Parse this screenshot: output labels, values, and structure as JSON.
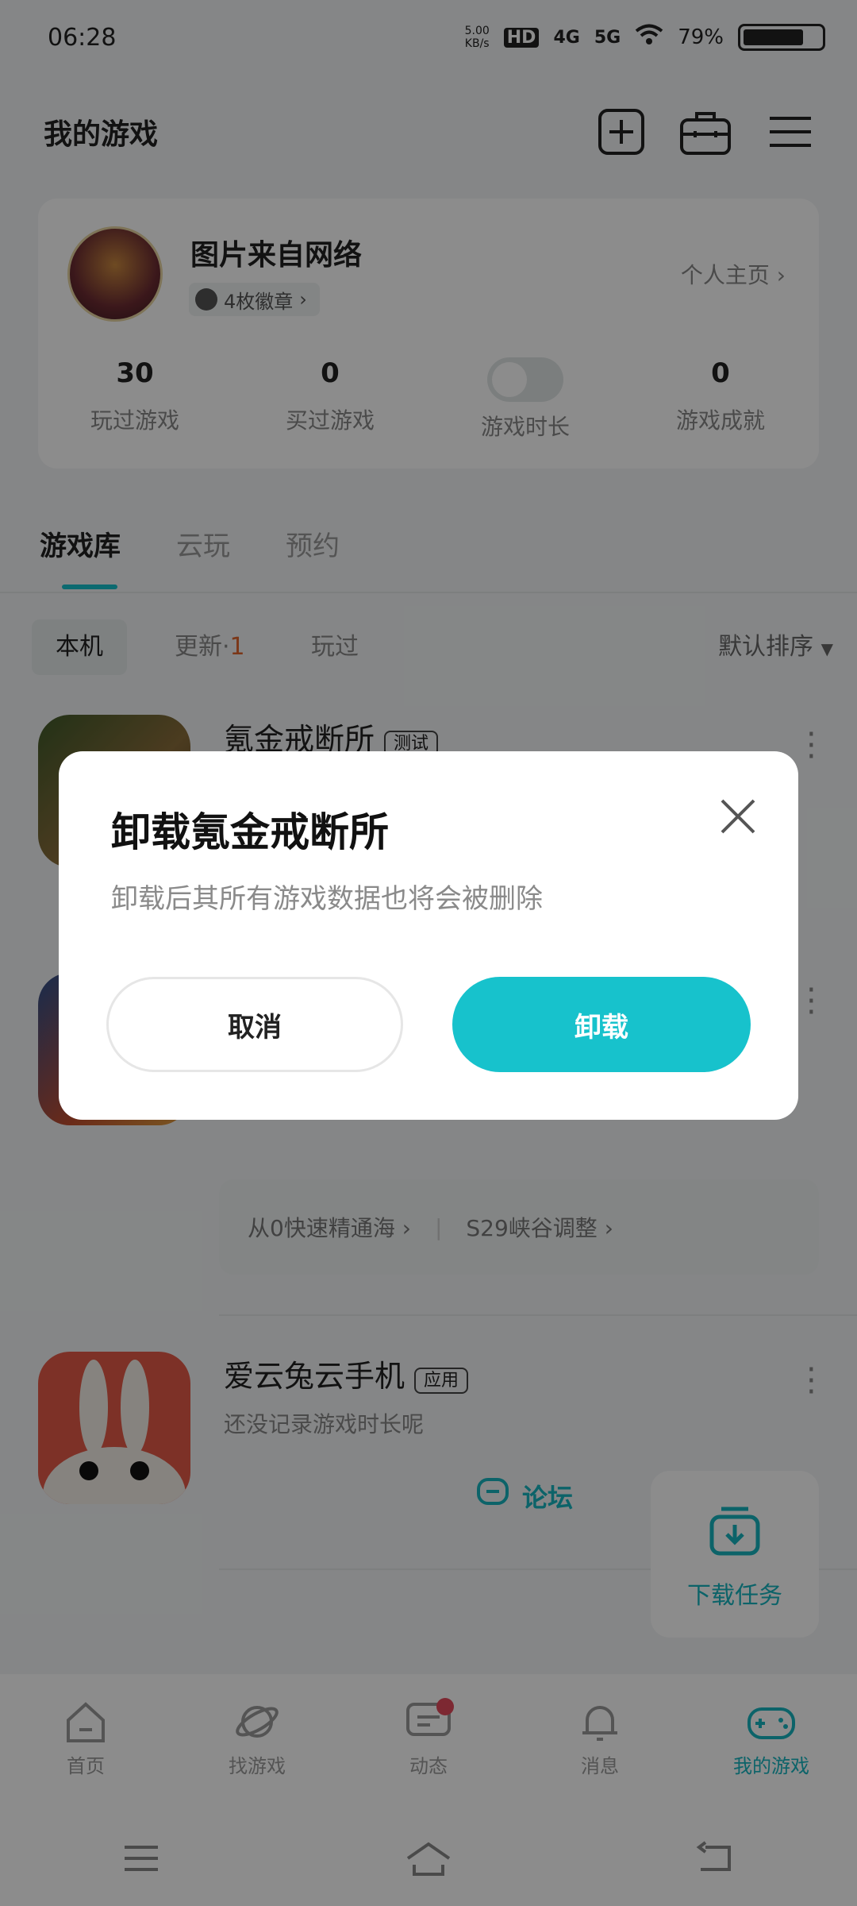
{
  "status": {
    "time": "06:28",
    "speed_top": "5.00",
    "speed_bottom": "KB/s",
    "hd": "HD",
    "net1": "4G",
    "net2": "5G",
    "battery": "79%"
  },
  "header": {
    "title": "我的游戏"
  },
  "profile": {
    "name": "图片来自网络",
    "badge": "4枚徽章",
    "homepage": "个人主页",
    "stats": [
      {
        "num": "30",
        "label": "玩过游戏"
      },
      {
        "num": "0",
        "label": "买过游戏"
      },
      {
        "num": "",
        "label": "游戏时长"
      },
      {
        "num": "0",
        "label": "游戏成就"
      }
    ]
  },
  "tabs": [
    "游戏库",
    "云玩",
    "预约"
  ],
  "filters": {
    "local": "本机",
    "update": "更新",
    "update_dot": "·",
    "update_count": "1",
    "played": "玩过",
    "sort": "默认排序"
  },
  "games": [
    {
      "name": "氪金戒断所",
      "tag": "测试"
    },
    {
      "strip_1": "从0快速精通海",
      "strip_2": "S29峡谷调整"
    },
    {
      "name": "爱云兔云手机",
      "tag": "应用",
      "sub": "还没记录游戏时长呢",
      "forum": "论坛"
    }
  ],
  "download": {
    "label": "下载任务"
  },
  "nav": [
    "首页",
    "找游戏",
    "动态",
    "消息",
    "我的游戏"
  ],
  "dialog": {
    "title": "卸载氪金戒断所",
    "message": "卸载后其所有游戏数据也将会被删除",
    "cancel": "取消",
    "confirm": "卸载"
  },
  "colors": {
    "accent": "#17c2cc",
    "overlay": "rgba(0,0,0,0.45)"
  }
}
